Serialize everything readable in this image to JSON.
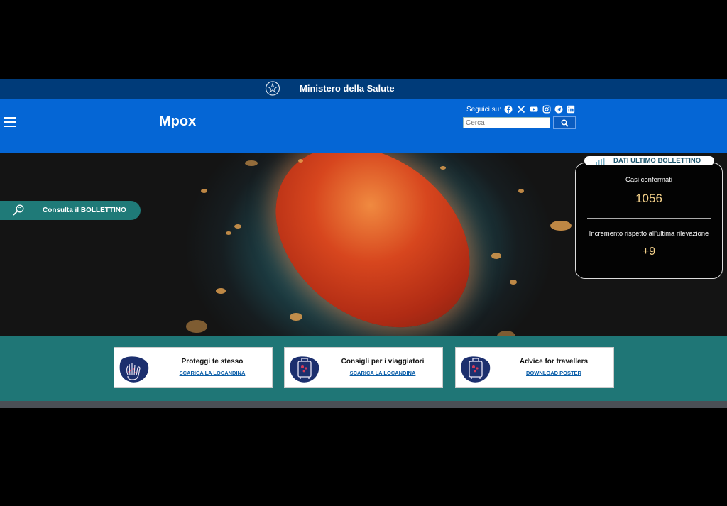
{
  "topbar": {
    "ministry": "Ministero della Salute"
  },
  "header": {
    "title": "Mpox",
    "follow_label": "Seguici su:",
    "social": [
      "facebook-icon",
      "x-icon",
      "youtube-icon",
      "instagram-icon",
      "telegram-icon",
      "linkedin-icon"
    ]
  },
  "search": {
    "placeholder": "Cerca"
  },
  "hero": {
    "bulletin_label": "Consulta il BOLLETTINO"
  },
  "data_box": {
    "tab_label": "DATI ULTIMO BOLLETTINO",
    "cases_label": "Casi confermati",
    "cases_value": "1056",
    "increment_label": "Incremento rispetto all'ultima rilevazione",
    "increment_value": "+9"
  },
  "cards": [
    {
      "title": "Proteggi te stesso",
      "link": "SCARICA LA LOCANDINA",
      "icon": "hand-icon"
    },
    {
      "title": "Consigli per i viaggiatori",
      "link": "SCARICA LA LOCANDINA",
      "icon": "luggage-icon"
    },
    {
      "title": "Advice for travellers",
      "link": "DOWNLOAD POSTER",
      "icon": "luggage-icon"
    }
  ],
  "colors": {
    "topbar": "#003b79",
    "header": "#0566d5",
    "teal": "#1f7676",
    "value": "#f4d18a"
  }
}
